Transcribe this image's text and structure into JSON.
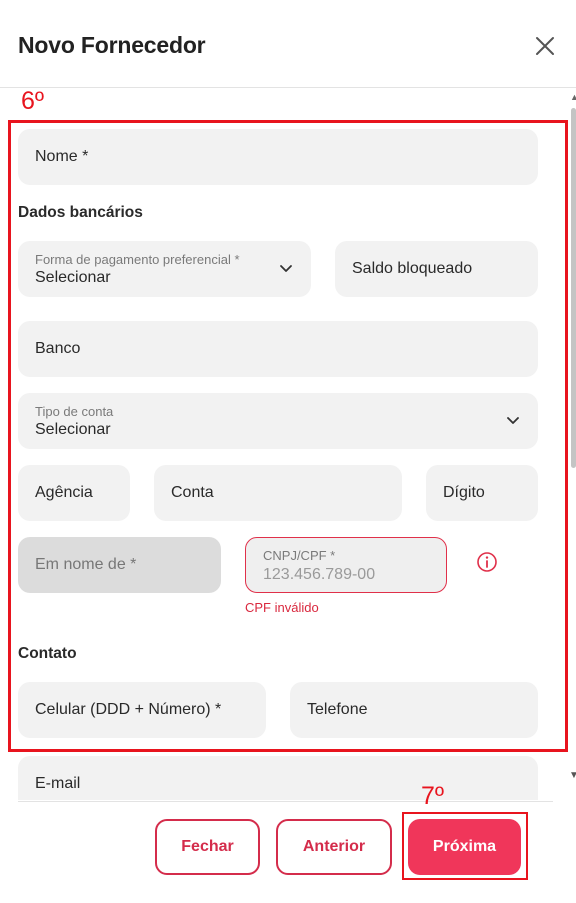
{
  "header": {
    "title": "Novo Fornecedor"
  },
  "annotations": {
    "step_form": "6º",
    "step_next": "7º"
  },
  "form": {
    "nome": "Nome *",
    "section_bank": "Dados bancários",
    "forma_pagamento": {
      "label": "Forma de pagamento preferencial *",
      "value": "Selecionar"
    },
    "saldo_bloqueado": "Saldo bloqueado",
    "banco": "Banco",
    "tipo_conta": {
      "label": "Tipo de conta",
      "value": "Selecionar"
    },
    "agencia": "Agência",
    "conta": "Conta",
    "digito": "Dígito",
    "em_nome_de": "Em nome de *",
    "cnpj_cpf": {
      "label": "CNPJ/CPF *",
      "value": "123.456.789-00",
      "error": "CPF inválido"
    },
    "section_contact": "Contato",
    "celular": "Celular (DDD + Número) *",
    "telefone": "Telefone",
    "email": "E-mail"
  },
  "footer": {
    "close_label": "Fechar",
    "previous_label": "Anterior",
    "next_label": "Próxima"
  },
  "colors": {
    "accent": "#f0365a",
    "annotation": "#e8141e",
    "error": "#d9283e"
  },
  "icons": {
    "close": "close-icon",
    "chevron": "chevron-down-icon",
    "info": "info-icon"
  }
}
